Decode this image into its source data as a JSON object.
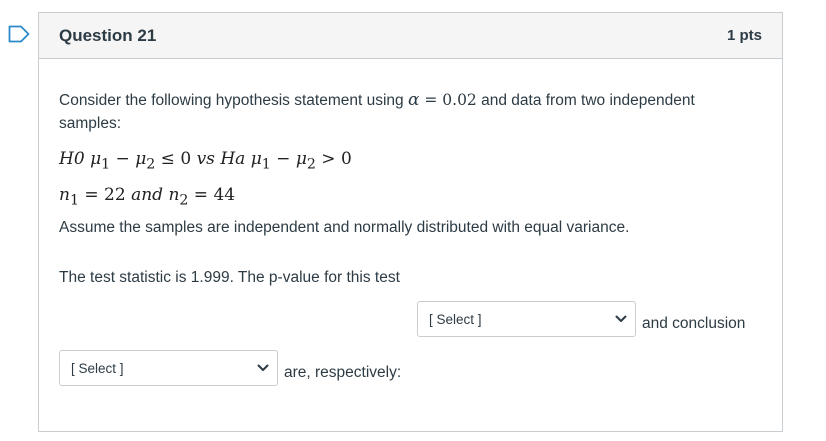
{
  "question": {
    "title": "Question 21",
    "points": "1 pts",
    "intro_before_alpha": "Consider the following hypothesis statement using ",
    "alpha_symbol": "α",
    "alpha_value": " = 0.02",
    "intro_after_alpha": " and data from two independent samples:",
    "hypothesis": {
      "h0": "H0",
      "lhs": "μ",
      "sub1": "1",
      "minus": " − ",
      "sub2": "2",
      "le": " ≤ ",
      "zero": "0",
      "vs": " vs ",
      "ha": "Ha",
      "gt": " > "
    },
    "samples": {
      "n": "n",
      "eq1": " = 22 ",
      "and": "and",
      "eq2": " = 44"
    },
    "assumption": "Assume the samples are independent and normally distributed with equal variance.",
    "statement_before": "The test statistic is 1.999. The p-value for this test",
    "statement_middle": "and conclusion",
    "statement_after": "are, respectively:",
    "select1": {
      "value": "[ Select ]"
    },
    "select2": {
      "value": "[ Select ]"
    }
  },
  "colors": {
    "flag": "#2d8acb",
    "header_bg": "#f5f5f5",
    "border": "#c7cdd1",
    "text": "#2d3b45"
  }
}
